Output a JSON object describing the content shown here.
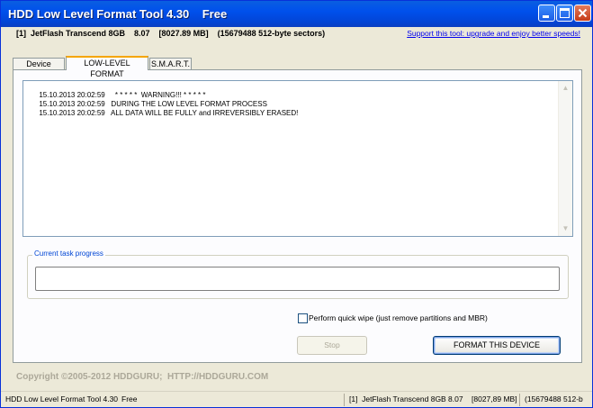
{
  "window": {
    "title": "HDD Low Level Format Tool 4.30    Free"
  },
  "device_info": {
    "summary": "[1]  JetFlash Transcend 8GB    8.07    [8027.89 MB]    (15679488 512-byte sectors)",
    "support_link": "Support this tool: upgrade and enjoy better speeds!"
  },
  "tabs": [
    {
      "label": "Device details",
      "active": false
    },
    {
      "label": "LOW-LEVEL FORMAT",
      "active": true
    },
    {
      "label": "S.M.A.R.T.",
      "active": false
    }
  ],
  "log": {
    "lines": [
      {
        "time": "15.10.2013 20:02:59",
        "text": "  * * * * *  WARNING!!! * * * * *"
      },
      {
        "time": "15.10.2013 20:02:59",
        "text": "DURING THE LOW LEVEL FORMAT PROCESS"
      },
      {
        "time": "15.10.2013 20:02:59",
        "text": "ALL DATA WILL BE FULLY and IRREVERSIBLY ERASED!"
      }
    ]
  },
  "progress": {
    "label": "Current task progress",
    "value": 0
  },
  "options": {
    "quick_wipe_label": "Perform quick wipe (just remove partitions and MBR)",
    "quick_wipe_checked": false
  },
  "buttons": {
    "stop": "Stop",
    "format": "FORMAT THIS DEVICE"
  },
  "footer": {
    "copyright": "Copyright ©2005-2012 HDDGURU;  HTTP://HDDGURU.COM"
  },
  "statusbar": {
    "app": "HDD Low Level Format Tool 4.30",
    "edition": "Free",
    "device": "[1]  JetFlash Transcend 8GB",
    "firmware": "8.07",
    "size": "[8027,89 MB]",
    "sectors": "(15679488 512-b"
  },
  "colors": {
    "titlebar": "#0050ec",
    "window_bg": "#ece9d8",
    "link": "#0000ee",
    "group_label": "#0046d5",
    "active_tab_accent": "#f5a500"
  }
}
